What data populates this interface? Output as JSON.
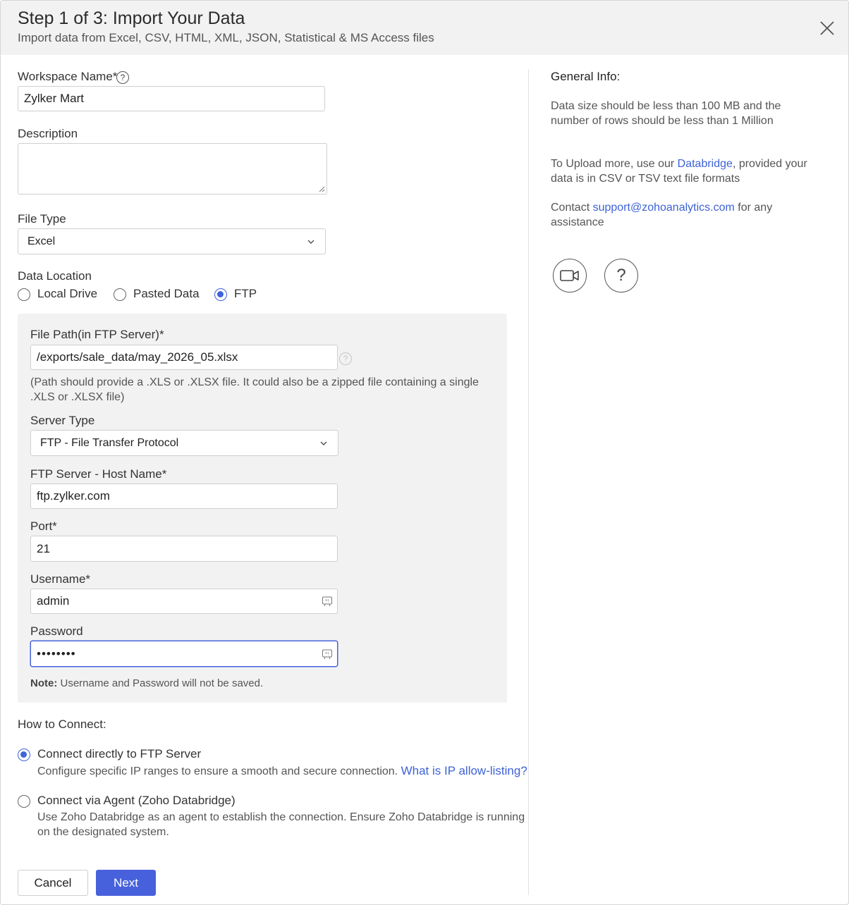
{
  "header": {
    "title": "Step 1 of 3: Import Your Data",
    "subtitle": "Import data from Excel, CSV, HTML, XML, JSON, Statistical & MS Access files"
  },
  "workspace": {
    "label": "Workspace Name*",
    "value": "Zylker Mart"
  },
  "description": {
    "label": "Description",
    "value": ""
  },
  "file_type": {
    "label": "File Type",
    "selected": "Excel"
  },
  "data_location": {
    "label": "Data Location",
    "options": [
      {
        "label": "Local Drive",
        "selected": false
      },
      {
        "label": "Pasted Data",
        "selected": false
      },
      {
        "label": "FTP",
        "selected": true
      }
    ]
  },
  "ftp": {
    "file_path_label": "File Path(in FTP Server)*",
    "file_path_value": "/exports/sale_data/may_2026_05.xlsx",
    "file_path_hint_1": "(Path should provide a .XLS or .XLSX file. It could also be a zipped file containing a single",
    "file_path_hint_2": ".XLS or .XLSX file)",
    "server_type_label": "Server Type",
    "server_type_selected": "FTP - File Transfer Protocol",
    "host_label": "FTP Server - Host Name*",
    "host_value": "ftp.zylker.com",
    "port_label": "Port*",
    "port_value": "21",
    "username_label": "Username*",
    "username_value": "admin",
    "password_label": "Password",
    "password_value": "••••••••",
    "note_bold": "Note:",
    "note_text": " Username and Password will not be saved."
  },
  "how_to_connect": {
    "label": "How to Connect:",
    "options": [
      {
        "label": "Connect directly to FTP Server",
        "selected": true,
        "desc": "Configure specific IP ranges to ensure a smooth and secure connection.",
        "link": "What is IP allow-listing?"
      },
      {
        "label": "Connect via Agent (Zoho Databridge)",
        "selected": false,
        "desc_1": "Use Zoho Databridge as an agent to establish the connection. Ensure Zoho Databridge is running",
        "desc_2": "on the designated system."
      }
    ]
  },
  "buttons": {
    "cancel": "Cancel",
    "next": "Next"
  },
  "info": {
    "title": "General Info:",
    "size_line_1": "Data size should be less than 100 MB and the",
    "size_line_2": "number of rows should be less than 1 Million",
    "upload_pre": "To Upload more, use our ",
    "upload_link": "Databridge",
    "upload_post": ", provided your",
    "upload_line_2": "data is in CSV or TSV text file formats",
    "contact_pre": "Contact ",
    "contact_link": "support@zohoanalytics.com",
    "contact_post": " for any",
    "contact_line_2": "assistance",
    "video_icon": "video-icon",
    "help_icon": "help-icon",
    "help_glyph": "?"
  },
  "colors": {
    "accent": "#4761dc",
    "link": "#3d62d6",
    "header_bg": "#f2f2f2",
    "panel_bg": "#f2f2f2"
  }
}
